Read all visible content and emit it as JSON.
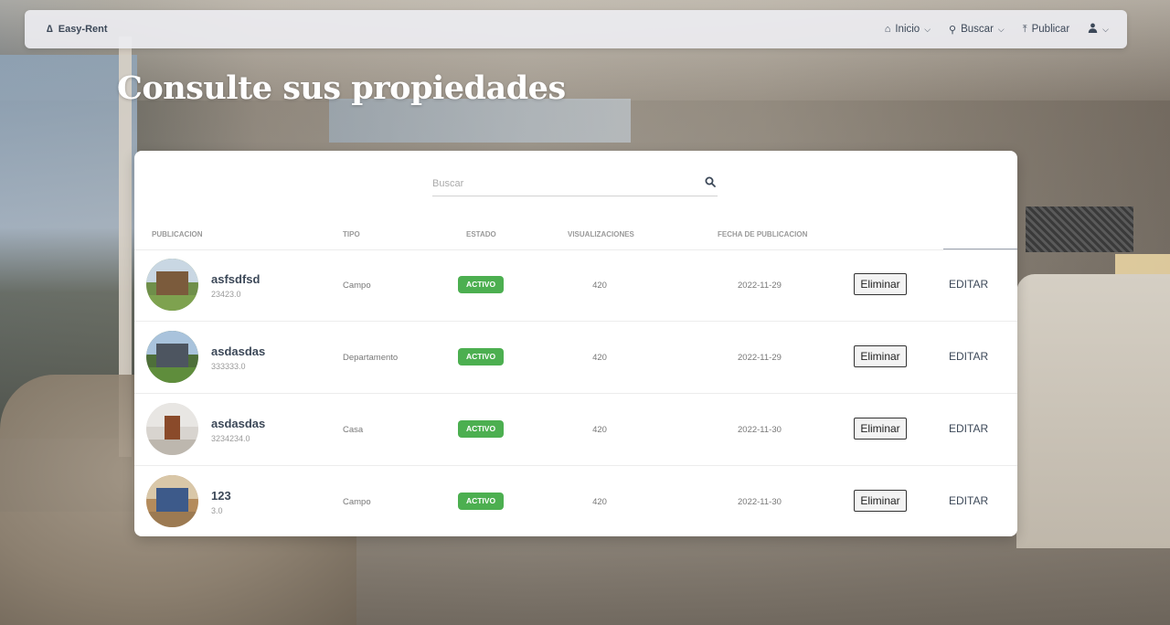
{
  "navbar": {
    "brand": "Easy-Rent",
    "items": [
      {
        "label": "Inicio",
        "icon": "home-icon"
      },
      {
        "label": "Buscar",
        "icon": "search-icon"
      },
      {
        "label": "Publicar",
        "icon": "upload-icon"
      },
      {
        "label": "",
        "icon": "user-icon"
      }
    ]
  },
  "page_title": "Consulte sus propiedades",
  "search": {
    "placeholder": "Buscar"
  },
  "table": {
    "headers": [
      "PUBLICACION",
      "TIPO",
      "ESTADO",
      "VISUALIZACIONES",
      "FECHA DE PUBLICACION"
    ],
    "rows": [
      {
        "title": "asfsdfsd",
        "price": "23423.0",
        "tipo": "Campo",
        "estado": "ACTIVO",
        "views": "420",
        "fecha": "2022-11-29",
        "delete_label": "Eliminar",
        "edit_label": "EDITAR"
      },
      {
        "title": "asdasdas",
        "price": "333333.0",
        "tipo": "Departamento",
        "estado": "ACTIVO",
        "views": "420",
        "fecha": "2022-11-29",
        "delete_label": "Eliminar",
        "edit_label": "EDITAR"
      },
      {
        "title": "asdasdas",
        "price": "3234234.0",
        "tipo": "Casa",
        "estado": "ACTIVO",
        "views": "420",
        "fecha": "2022-11-30",
        "delete_label": "Eliminar",
        "edit_label": "EDITAR"
      },
      {
        "title": "123",
        "price": "3.0",
        "tipo": "Campo",
        "estado": "ACTIVO",
        "views": "420",
        "fecha": "2022-11-30",
        "delete_label": "Eliminar",
        "edit_label": "EDITAR"
      }
    ]
  },
  "colors": {
    "badge_active": "#4caf50",
    "text_primary": "#3c4858",
    "title": "#ffffff"
  }
}
